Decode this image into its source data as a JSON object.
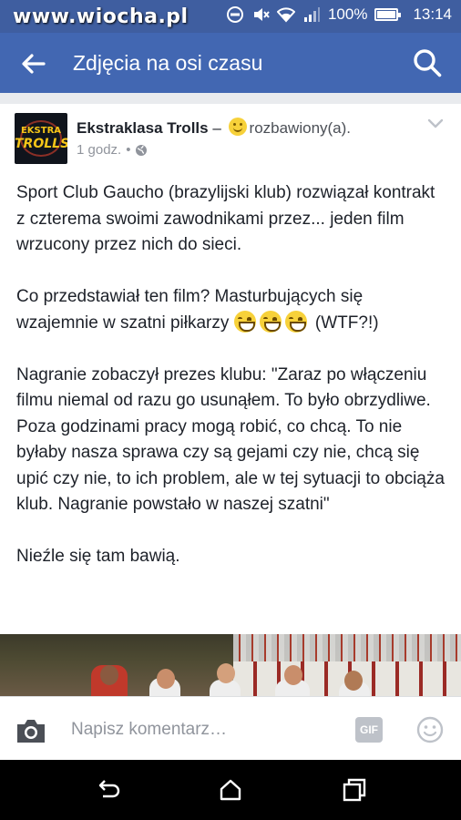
{
  "status_bar": {
    "watermark": "www.wiocha.pl",
    "battery": "100%",
    "battery_level": 1.0,
    "time": "13:14",
    "icons": [
      "dnd-icon",
      "mute-icon",
      "wifi-icon",
      "signal-icon",
      "battery-icon"
    ]
  },
  "app_bar": {
    "title": "Zdjęcia na osi czasu",
    "back_icon": "arrow-left-icon",
    "search_icon": "search-icon"
  },
  "post": {
    "author": "Ekstraklasa Trolls",
    "avatar_text": [
      "EKSTRA",
      "TROLLS"
    ],
    "separator": "–",
    "feeling": "rozbawiony(a).",
    "time": "1 godz.",
    "dot": "•",
    "paragraph1": "Sport Club Gaucho (brazylijski klub) rozwiązał kontrakt z czterema swoimi zawodnikami przez... jeden film wrzucony przez nich do sieci.",
    "paragraph2_text": "Co przedstawiał ten film? Masturbujących się wzajemnie w szatni piłkarzy",
    "paragraph2_suffix": "(WTF?!)",
    "paragraph3": "Nagranie zobaczył prezes klubu: \"Zaraz po włączeniu filmu niemal od razu go usunąłem. To było obrzydliwe. Poza godzinami pracy mogą robić, co chcą. To nie byłaby nasza sprawa czy są gejami czy nie, chcą się upić czy nie, to ich problem, ale w tej sytuacji to obciąża klub. Nagranie powstało w naszej szatni\"",
    "paragraph4": "Nieźle się tam bawią."
  },
  "comment_bar": {
    "placeholder": "Napisz komentarz…",
    "gif_label": "GIF"
  },
  "colors": {
    "status_bar": "#3f5ea0",
    "app_bar": "#4267b2",
    "text": "#1d2129",
    "meta": "#90949c"
  }
}
